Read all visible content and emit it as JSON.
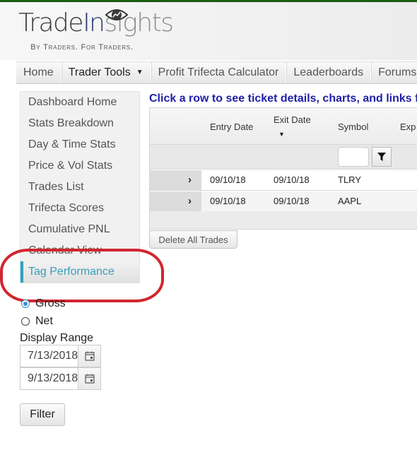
{
  "brand": {
    "name_part1": "Trade",
    "name_part2": "In",
    "name_part3": "sights",
    "tagline": "By Traders. For Traders.",
    "accent_color": "#1a5e12"
  },
  "nav": {
    "items": [
      {
        "label": "Home"
      },
      {
        "label": "Trader Tools",
        "has_dropdown": true
      },
      {
        "label": "Profit Trifecta Calculator"
      },
      {
        "label": "Leaderboards"
      },
      {
        "label": "Forums"
      }
    ]
  },
  "sidebar": {
    "items": [
      {
        "label": "Dashboard Home"
      },
      {
        "label": "Stats Breakdown"
      },
      {
        "label": "Day & Time Stats"
      },
      {
        "label": "Price & Vol Stats"
      },
      {
        "label": "Trades List"
      },
      {
        "label": "Trifecta Scores"
      },
      {
        "label": "Cumulative PNL"
      },
      {
        "label": "Calendar View"
      },
      {
        "label": "Tag Performance",
        "active": true
      }
    ],
    "active_color": "#2aa3c0"
  },
  "annotation": {
    "type": "red-ellipse-highlight",
    "color": "#d0262e",
    "target": "Tag Performance"
  },
  "options": {
    "pnl_mode": {
      "options": [
        {
          "label": "Gross",
          "checked": true
        },
        {
          "label": "Net",
          "checked": false
        }
      ]
    },
    "display_range": {
      "label": "Display Range",
      "start": "7/13/2018",
      "end": "9/13/2018"
    },
    "filter_label": "Filter"
  },
  "trades": {
    "hint": "Click a row to see ticket details, charts, and links f",
    "columns": [
      {
        "label": "Entry Date"
      },
      {
        "label": "Exit Date",
        "sorted": "desc"
      },
      {
        "label": "Symbol"
      },
      {
        "label": "Exp"
      }
    ],
    "symbol_filter_value": "",
    "rows": [
      {
        "entry": "09/10/18",
        "exit": "09/10/18",
        "symbol": "TLRY"
      },
      {
        "entry": "09/10/18",
        "exit": "09/10/18",
        "symbol": "AAPL"
      }
    ],
    "delete_label": "Delete All Trades"
  }
}
